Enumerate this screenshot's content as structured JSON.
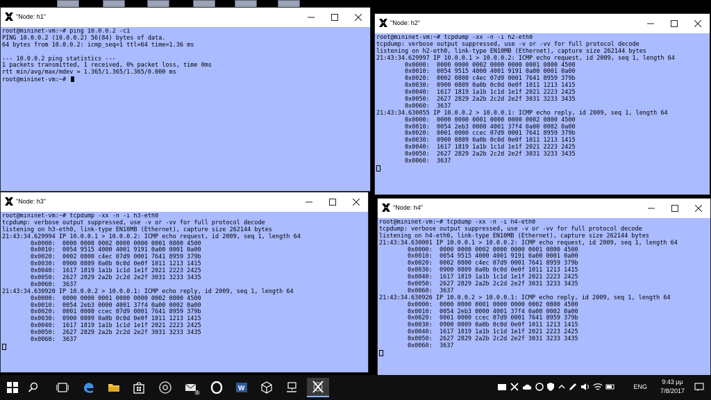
{
  "windows": [
    {
      "title": "\"Node: h1\"",
      "lines": [
        "root@mininet-vm:~# ping 10.0.0.2 -c1",
        "PING 10.0.0.2 (10.0.0.2) 56(84) bytes of data.",
        "64 bytes from 10.0.0.2: icmp_seq=1 ttl=64 time=1.36 ms",
        "",
        "--- 10.0.0.2 ping statistics ---",
        "1 packets transmitted, 1 received, 0% packet loss, time 0ms",
        "rtt min/avg/max/mdev = 1.365/1.365/1.365/0.000 ms",
        "root@mininet-vm:~# "
      ]
    },
    {
      "title": "\"Node: h2\"",
      "lines": [
        "root@mininet-vm:~# tcpdump -xx -n -i h2-eth0",
        "tcpdump: verbose output suppressed, use -v or -vv for full protocol decode",
        "listening on h2-eth0, link-type EN10MB (Ethernet), capture size 262144 bytes",
        "21:43:34.629997 IP 10.0.0.1 > 10.0.0.2: ICMP echo request, id 2009, seq 1, length 64",
        "        0x0000:  0000 0000 0002 0000 0000 0001 0800 4500",
        "        0x0010:  0054 9515 4000 4001 9191 0a00 0001 0a00",
        "        0x0020:  0002 0800 c4ec 07d9 0001 7641 8959 379b",
        "        0x0030:  0900 0809 0a0b 0c0d 0e0f 1011 1213 1415",
        "        0x0040:  1617 1819 1a1b 1c1d 1e1f 2021 2223 2425",
        "        0x0050:  2627 2829 2a2b 2c2d 2e2f 3031 3233 3435",
        "        0x0060:  3637",
        "21:43:34.630055 IP 10.0.0.2 > 10.0.0.1: ICMP echo reply, id 2009, seq 1, length 64",
        "        0x0000:  0000 0000 0001 0000 0000 0002 0800 4500",
        "        0x0010:  0054 2eb3 0000 4001 37f4 0a00 0002 0a00",
        "        0x0020:  0001 0000 ccec 07d9 0001 7641 8959 379b",
        "        0x0030:  0900 0809 0a0b 0c0d 0e0f 1011 1213 1415",
        "        0x0040:  1617 1819 1a1b 1c1d 1e1f 2021 2223 2425",
        "        0x0050:  2627 2829 2a2b 2c2d 2e2f 3031 3233 3435",
        "        0x0060:  3637"
      ]
    },
    {
      "title": "\"Node: h3\"",
      "lines": [
        "root@mininet-vm:~# tcpdump -xx -n -i h3-eth0",
        "tcpdump: verbose output suppressed, use -v or -vv for full protocol decode",
        "listening on h3-eth0, link-type EN10MB (Ethernet), capture size 262144 bytes",
        "21:43:34.629994 IP 10.0.0.1 > 10.0.0.2: ICMP echo request, id 2009, seq 1, length 64",
        "        0x0000:  0000 0000 0002 0000 0000 0001 0800 4500",
        "        0x0010:  0054 9515 4000 4001 9191 0a00 0001 0a00",
        "        0x0020:  0002 0800 c4ec 07d9 0001 7641 8959 379b",
        "        0x0030:  0900 0809 0a0b 0c0d 0e0f 1011 1213 1415",
        "        0x0040:  1617 1819 1a1b 1c1d 1e1f 2021 2223 2425",
        "        0x0050:  2627 2829 2a2b 2c2d 2e2f 3031 3233 3435",
        "        0x0060:  3637",
        "21:43:34.630920 IP 10.0.0.2 > 10.0.0.1: ICMP echo reply, id 2009, seq 1, length 64",
        "        0x0000:  0000 0000 0001 0000 0000 0002 0800 4500",
        "        0x0010:  0054 2eb3 0000 4001 37f4 0a00 0002 0a00",
        "        0x0020:  0001 0000 ccec 07d9 0001 7641 8959 379b",
        "        0x0030:  0900 0809 0a0b 0c0d 0e0f 1011 1213 1415",
        "        0x0040:  1617 1819 1a1b 1c1d 1e1f 2021 2223 2425",
        "        0x0050:  2627 2829 2a2b 2c2d 2e2f 3031 3233 3435",
        "        0x0060:  3637"
      ]
    },
    {
      "title": "\"Node: h4\"",
      "lines": [
        "root@mininet-vm:~# tcpdump -xx -n -i h4-eth0",
        "tcpdump: verbose output suppressed, use -v or -vv for full protocol decode",
        "listening on h4-eth0, link-type EN10MB (Ethernet), capture size 262144 bytes",
        "21:43:34.630001 IP 10.0.0.1 > 10.0.0.2: ICMP echo request, id 2009, seq 1, length 64",
        "        0x0000:  0000 0000 0002 0000 0000 0001 0800 4500",
        "        0x0010:  0054 9515 4000 4001 9191 0a00 0001 0a00",
        "        0x0020:  0002 0800 c4ec 07d9 0001 7641 8959 379b",
        "        0x0030:  0900 0809 0a0b 0c0d 0e0f 1011 1213 1415",
        "        0x0040:  1617 1819 1a1b 1c1d 1e1f 2021 2223 2425",
        "        0x0050:  2627 2829 2a2b 2c2d 2e2f 3031 3233 3435",
        "        0x0060:  3637",
        "21:43:34.630926 IP 10.0.0.2 > 10.0.0.1: ICMP echo reply, id 2009, seq 1, length 64",
        "        0x0000:  0000 0000 0001 0000 0000 0002 0800 4500",
        "        0x0010:  0054 2eb3 0000 4001 37f4 0a00 0002 0a00",
        "        0x0020:  0001 0000 ccec 07d9 0001 7641 8959 379b",
        "        0x0030:  0900 0809 0a0b 0c0d 0e0f 1011 1213 1415",
        "        0x0040:  1617 1819 1a1b 1c1d 1e1f 2021 2223 2425",
        "        0x0050:  2627 2829 2a2b 2c2d 2e2f 3031 3233 3435",
        "        0x0060:  3637"
      ]
    }
  ],
  "taskbar": {
    "language": "ENG",
    "time": "9:43 μμ",
    "date": "7/8/2017",
    "badge_count": "1"
  },
  "colors": {
    "terminal_bg": "#aabbff",
    "taskbar_bg": "#101010"
  }
}
